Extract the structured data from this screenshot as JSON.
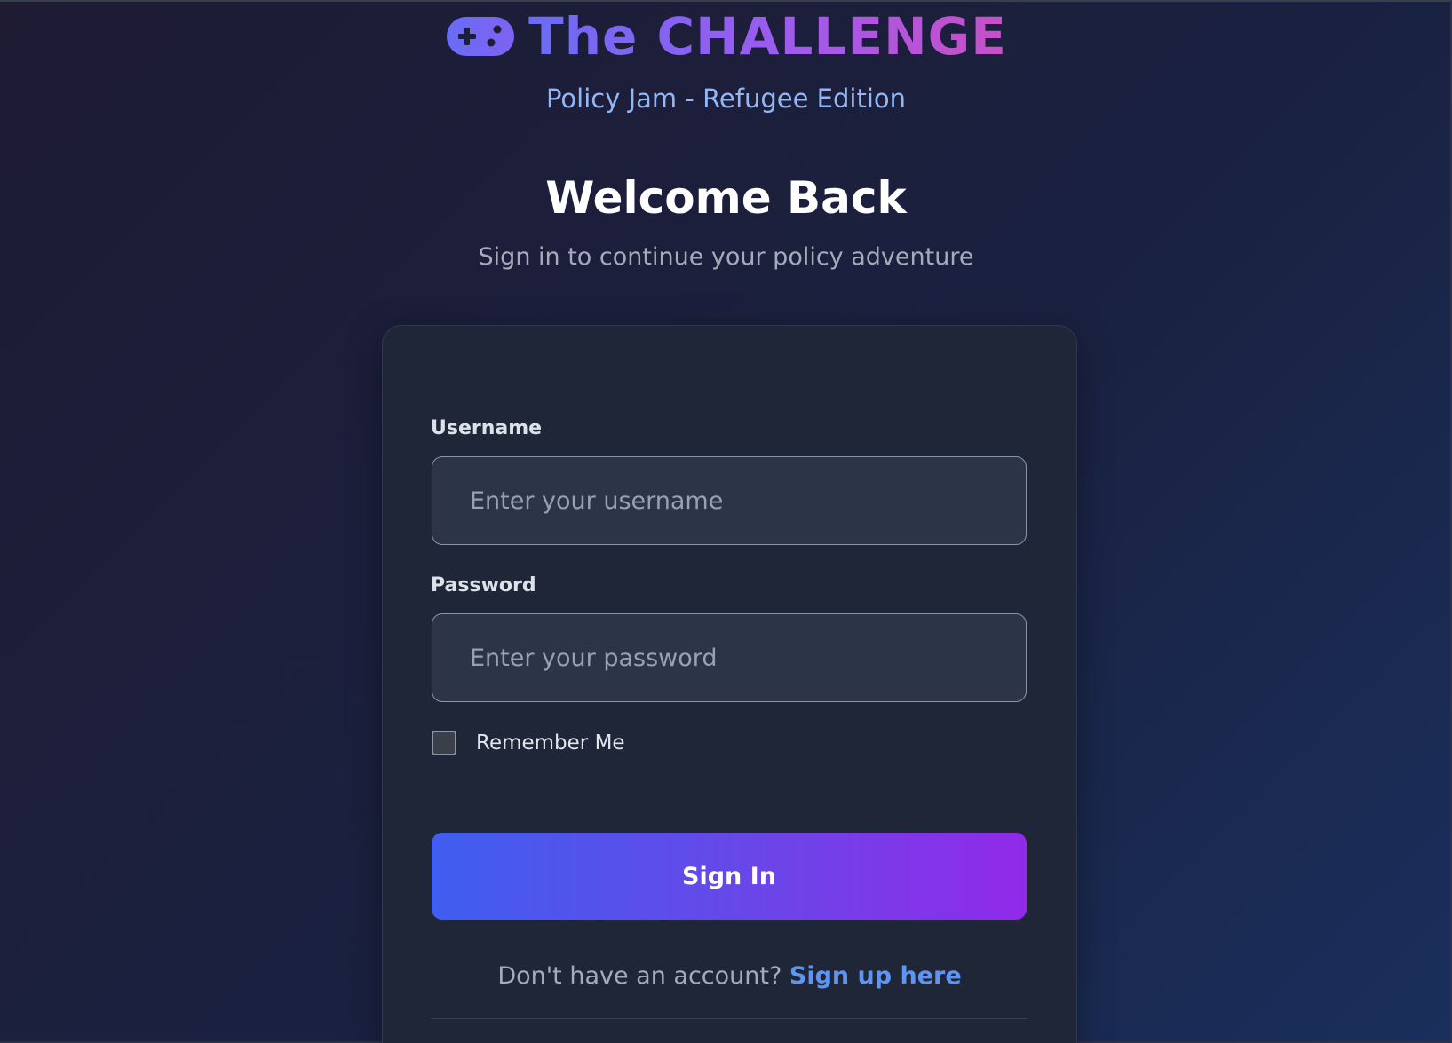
{
  "header": {
    "icon": "gamepad-icon",
    "title": "The CHALLENGE",
    "subtitle": "Policy Jam - Refugee Edition"
  },
  "welcome": {
    "title": "Welcome Back",
    "subtitle": "Sign in to continue your policy adventure"
  },
  "form": {
    "username_label": "Username",
    "username_placeholder": "Enter your username",
    "username_value": "",
    "password_label": "Password",
    "password_placeholder": "Enter your password",
    "password_value": "",
    "remember_label": "Remember Me",
    "remember_checked": false,
    "signin_label": "Sign In"
  },
  "footer": {
    "signup_prompt": "Don't have an account?",
    "signup_link": "Sign up here"
  },
  "colors": {
    "brand_gradient_start": "#6a6cf5",
    "brand_gradient_end": "#c94fc8",
    "subtitle": "#93b7f5",
    "button_gradient_start": "#3f5eef",
    "button_gradient_end": "#912ae9",
    "link": "#5e95f2",
    "card_background": "#1f2638"
  }
}
